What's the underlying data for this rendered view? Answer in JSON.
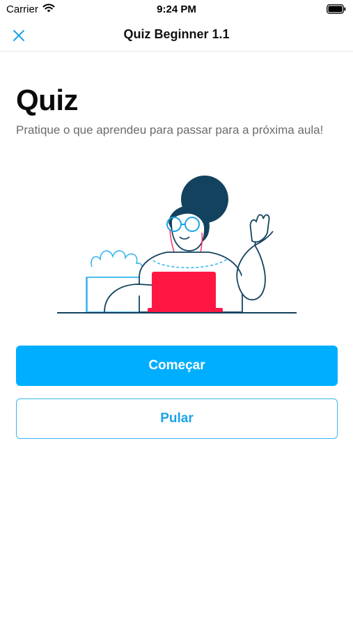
{
  "status_bar": {
    "carrier": "Carrier",
    "time": "9:24 PM",
    "icons": [
      "wifi-icon",
      "battery-icon"
    ]
  },
  "nav": {
    "title": "Quiz Beginner 1.1",
    "close_icon": "close-icon"
  },
  "content": {
    "title": "Quiz",
    "subtitle": "Pratique o que aprendeu para passar para a próxima aula!"
  },
  "illustration": "woman-with-laptop-waving",
  "buttons": {
    "start_label": "Começar",
    "skip_label": "Pular"
  },
  "colors": {
    "primary": "#00aeff",
    "secondary_text": "#1aa3e8",
    "laptop": "#ff1744",
    "line": "#1b3a5c"
  }
}
